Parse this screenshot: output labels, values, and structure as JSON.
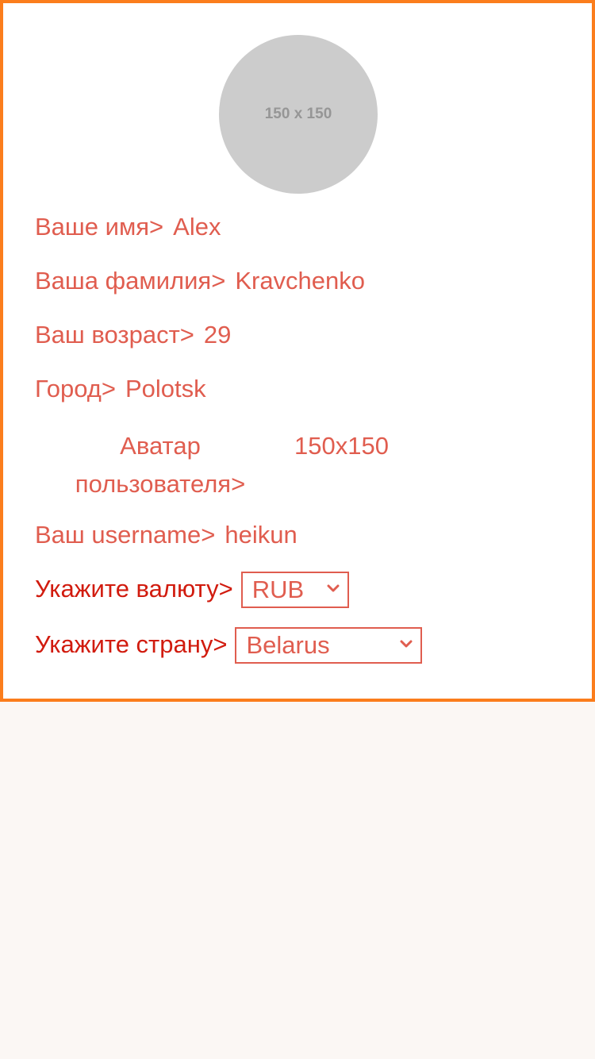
{
  "avatar": {
    "placeholder_text": "150 x 150"
  },
  "profile": {
    "first_name_label": "Ваше имя>",
    "first_name_value": "Alex",
    "last_name_label": "Ваша фамилия>",
    "last_name_value": "Kravchenko",
    "age_label": "Ваш возраст>",
    "age_value": "29",
    "city_label": "Город>",
    "city_value": "Polotsk",
    "avatar_label_line1": "Аватар",
    "avatar_label_line2": "пользователя>",
    "avatar_value": "150x150",
    "username_label": "Ваш username>",
    "username_value": "heikun"
  },
  "currency": {
    "label": "Укажите валюту>",
    "selected": "RUB"
  },
  "country": {
    "label": "Укажите страну>",
    "selected": "Belarus"
  },
  "colors": {
    "border": "#fb7d1c",
    "text": "#e05d4f",
    "select_label": "#d11b0e",
    "background": "#fbf7f4"
  }
}
